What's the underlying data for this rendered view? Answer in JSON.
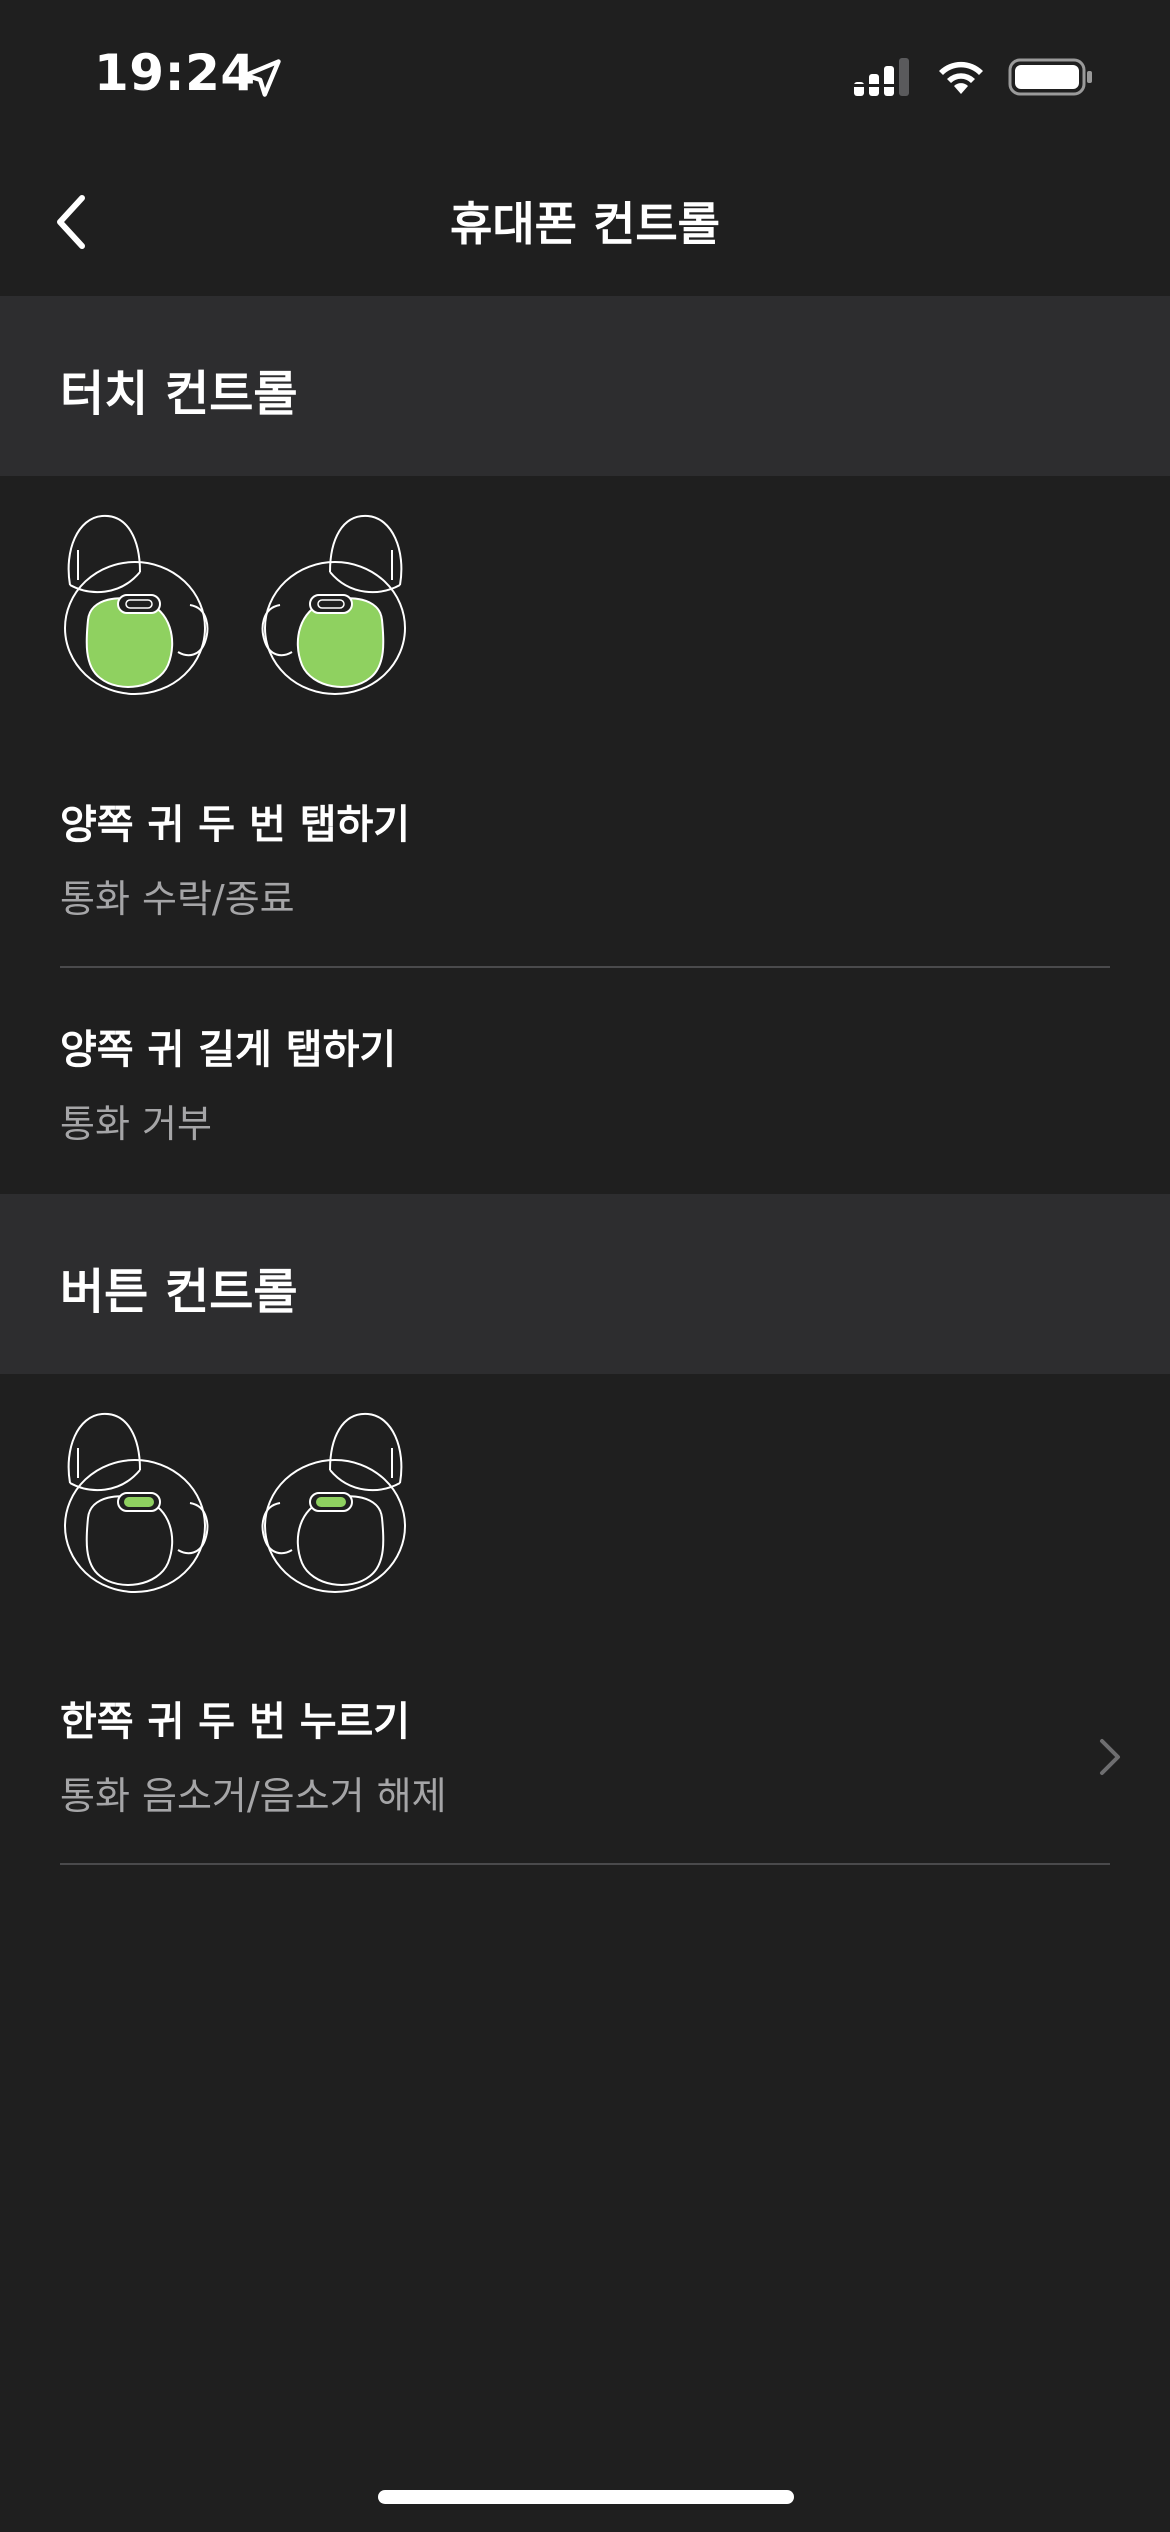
{
  "status_bar": {
    "time": "19:24",
    "icons": [
      "location-arrow-icon",
      "cellular-signal-icon",
      "wifi-icon",
      "battery-icon"
    ]
  },
  "nav": {
    "title": "휴대폰 컨트롤",
    "back_icon": "chevron-left-icon"
  },
  "touch_section": {
    "header": "터치 컨트롤",
    "illustration": "earbuds-touch-area-highlight",
    "items": [
      {
        "title": "양쪽 귀 두 번 탭하기",
        "subtitle": "통화 수락/종료"
      },
      {
        "title": "양쪽 귀 길게 탭하기",
        "subtitle": "통화 거부"
      }
    ]
  },
  "button_section": {
    "header": "버튼 컨트롤",
    "illustration": "earbuds-button-highlight",
    "items": [
      {
        "title": "한쪽 귀 두 번 누르기",
        "subtitle": "통화 음소거/음소거 해제",
        "chevron": "chevron-right-icon"
      }
    ]
  },
  "colors": {
    "background": "#1f1f1f",
    "section_header_bg": "#2d2d2f",
    "highlight_green": "#8fd160",
    "subtitle_gray": "#a5a5a7",
    "divider": "#4a4a4c"
  }
}
